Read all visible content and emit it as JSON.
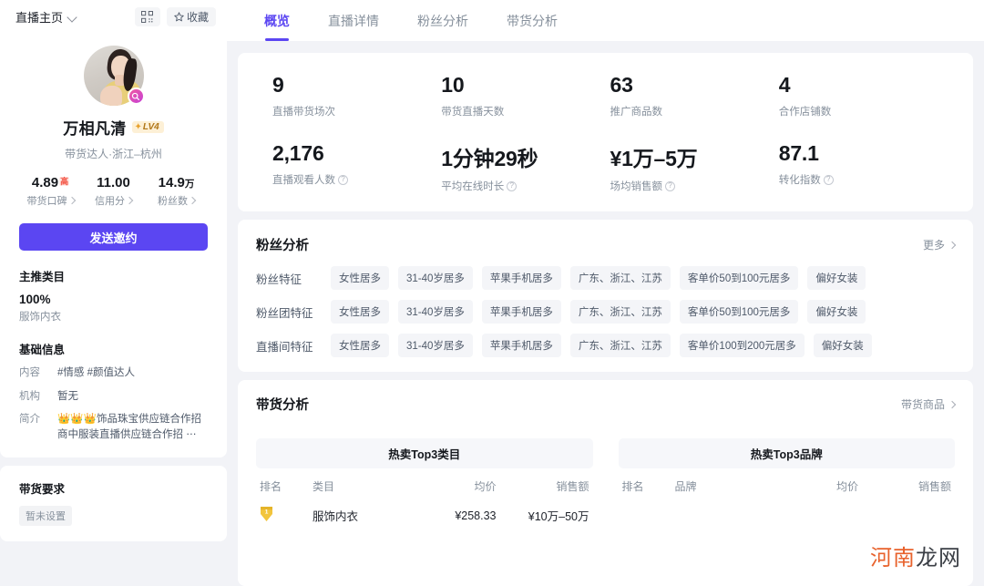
{
  "sidebar": {
    "home_label": "直播主页",
    "qr_icon": "qr-code-icon",
    "favorite_label": "收藏",
    "profile": {
      "name": "万相凡清",
      "level_badge": "LV4",
      "subtitle": "带货达人·浙江–杭州",
      "stats": [
        {
          "value": "4.89",
          "sup": "高",
          "label": "带货口碑"
        },
        {
          "value": "11.00",
          "sup": "",
          "label": "信用分"
        },
        {
          "value": "14.9",
          "unit": "万",
          "label": "粉丝数"
        }
      ]
    },
    "invite_button": "发送邀约",
    "main_category": {
      "title": "主推类目",
      "percent": "100%",
      "name": "服饰内衣"
    },
    "basic_info": {
      "title": "基础信息",
      "rows": [
        {
          "key": "内容",
          "value": "#情感  #颜值达人"
        },
        {
          "key": "机构",
          "value": "暂无"
        },
        {
          "key": "简介",
          "value": "👑👑👑饰品珠宝供应链合作招商中服装直播供应链合作招 ⋯"
        }
      ]
    },
    "requirement": {
      "title": "带货要求",
      "tag": "暂未设置"
    }
  },
  "tabs": [
    {
      "label": "概览",
      "active": true
    },
    {
      "label": "直播详情",
      "active": false
    },
    {
      "label": "粉丝分析",
      "active": false
    },
    {
      "label": "带货分析",
      "active": false
    }
  ],
  "metrics": [
    {
      "value": "9",
      "label": "直播带货场次",
      "help": false
    },
    {
      "value": "10",
      "label": "带货直播天数",
      "help": false
    },
    {
      "value": "63",
      "label": "推广商品数",
      "help": false
    },
    {
      "value": "4",
      "label": "合作店铺数",
      "help": false
    },
    {
      "value": "2,176",
      "label": "直播观看人数",
      "help": true
    },
    {
      "value": "1分钟29秒",
      "label": "平均在线时长",
      "help": true
    },
    {
      "value": "¥1万–5万",
      "label": "场均销售额",
      "help": true
    },
    {
      "value": "87.1",
      "label": "转化指数",
      "help": true
    }
  ],
  "fans": {
    "title": "粉丝分析",
    "more": "更多",
    "rows": [
      {
        "key": "粉丝特征",
        "chips": [
          "女性居多",
          "31-40岁居多",
          "苹果手机居多",
          "广东、浙江、江苏",
          "客单价50到100元居多",
          "偏好女装"
        ]
      },
      {
        "key": "粉丝团特征",
        "chips": [
          "女性居多",
          "31-40岁居多",
          "苹果手机居多",
          "广东、浙江、江苏",
          "客单价50到100元居多",
          "偏好女装"
        ]
      },
      {
        "key": "直播间特征",
        "chips": [
          "女性居多",
          "31-40岁居多",
          "苹果手机居多",
          "广东、浙江、江苏",
          "客单价100到200元居多",
          "偏好女装"
        ]
      }
    ]
  },
  "sales": {
    "title": "带货分析",
    "more": "带货商品",
    "category_table": {
      "header": "热卖Top3类目",
      "columns": [
        "排名",
        "类目",
        "均价",
        "销售额"
      ],
      "rows": [
        {
          "rank": "1",
          "name": "服饰内衣",
          "price": "¥258.33",
          "amount": "¥10万–50万"
        }
      ]
    },
    "brand_table": {
      "header": "热卖Top3品牌",
      "columns": [
        "排名",
        "品牌",
        "均价",
        "销售额"
      ],
      "rows": []
    }
  },
  "watermark": {
    "orange": "河南",
    "dark": "龙网"
  }
}
